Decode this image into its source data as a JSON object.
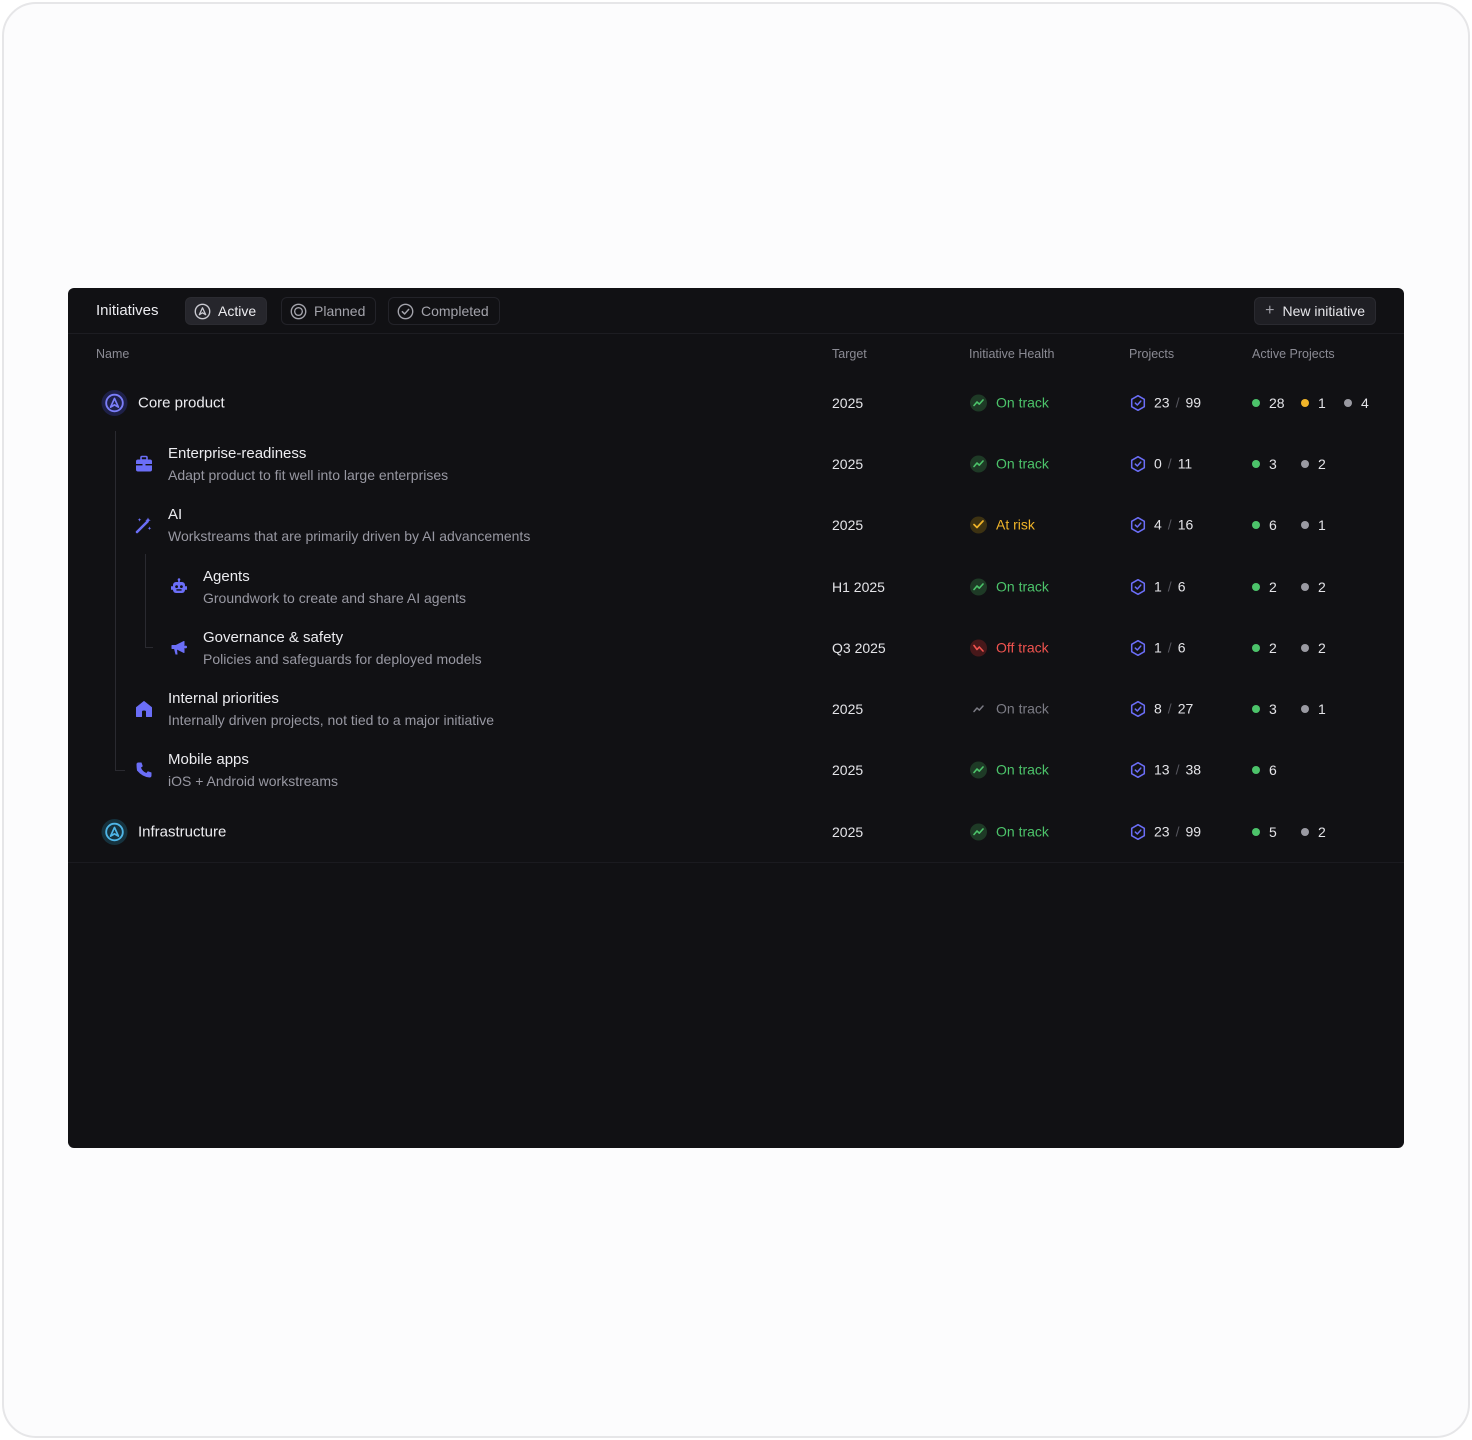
{
  "header": {
    "title": "Initiatives",
    "tabs": [
      {
        "label": "Active",
        "icon": "active-icon"
      },
      {
        "label": "Planned",
        "icon": "planned-icon"
      },
      {
        "label": "Completed",
        "icon": "completed-icon"
      }
    ],
    "new_button": "New initiative"
  },
  "columns": {
    "name": "Name",
    "target": "Target",
    "health": "Initiative Health",
    "projects": "Projects",
    "active": "Active Projects"
  },
  "colors": {
    "green": "#4cc36a",
    "yellow": "#f0b429",
    "red": "#f0534f",
    "gray": "#9a9aa2",
    "accent": "#6b6ef7"
  },
  "rows": [
    {
      "name": "Core product",
      "desc": "",
      "icon": "initiative-icon",
      "target": "2025",
      "health": "On track",
      "projects_done": "23",
      "projects_total": "99",
      "active": {
        "green": "28",
        "yellow": "1",
        "gray": "4"
      }
    },
    {
      "name": "Enterprise-readiness",
      "desc": "Adapt product to fit well into large enterprises",
      "icon": "briefcase-icon",
      "target": "2025",
      "health": "On track",
      "projects_done": "0",
      "projects_total": "11",
      "active": {
        "green": "3",
        "gray": "2"
      }
    },
    {
      "name": "AI",
      "desc": "Workstreams that are primarily driven by AI advancements",
      "icon": "magic-wand-icon",
      "target": "2025",
      "health": "At risk",
      "projects_done": "4",
      "projects_total": "16",
      "active": {
        "green": "6",
        "gray": "1"
      }
    },
    {
      "name": "Agents",
      "desc": "Groundwork to create and share AI agents",
      "icon": "robot-icon",
      "target": "H1 2025",
      "health": "On track",
      "projects_done": "1",
      "projects_total": "6",
      "active": {
        "green": "2",
        "gray": "2"
      }
    },
    {
      "name": "Governance & safety",
      "desc": "Policies and safeguards for deployed models",
      "icon": "megaphone-icon",
      "target": "Q3 2025",
      "health": "Off track",
      "projects_done": "1",
      "projects_total": "6",
      "active": {
        "green": "2",
        "gray": "2"
      }
    },
    {
      "name": "Internal priorities",
      "desc": "Internally driven projects, not tied to a major initiative",
      "icon": "house-icon",
      "target": "2025",
      "health": "On track",
      "projects_done": "8",
      "projects_total": "27",
      "active": {
        "green": "3",
        "gray": "1"
      }
    },
    {
      "name": "Mobile apps",
      "desc": "iOS + Android workstreams",
      "icon": "phone-icon",
      "target": "2025",
      "health": "On track",
      "projects_done": "13",
      "projects_total": "38",
      "active": {
        "green": "6"
      }
    },
    {
      "name": "Infrastructure",
      "desc": "",
      "icon": "initiative-icon",
      "target": "2025",
      "health": "On track",
      "projects_done": "23",
      "projects_total": "99",
      "active": {
        "green": "5",
        "gray": "2"
      }
    }
  ]
}
